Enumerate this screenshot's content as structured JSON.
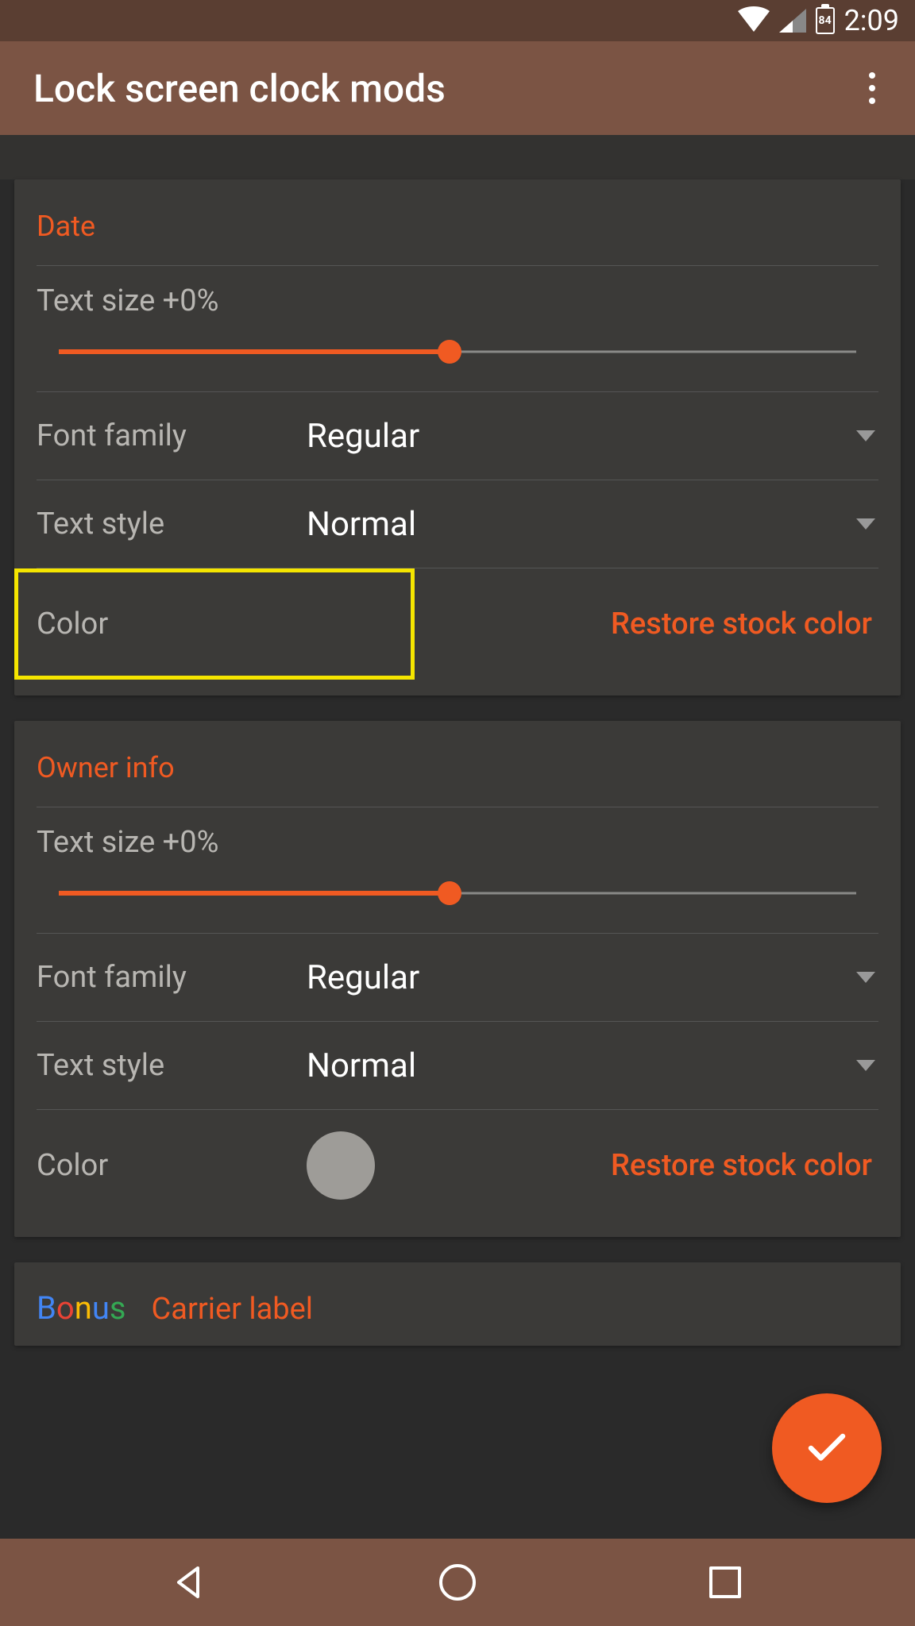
{
  "status": {
    "battery_level": "84",
    "time": "2:09"
  },
  "app_bar": {
    "title": "Lock screen clock mods"
  },
  "sections": {
    "date": {
      "title": "Date",
      "text_size_label": "Text size +0%",
      "slider_percent": 49,
      "font_family_label": "Font family",
      "font_family_value": "Regular",
      "text_style_label": "Text style",
      "text_style_value": "Normal",
      "color_label": "Color",
      "color_value": "#ffffff",
      "restore_label": "Restore stock color"
    },
    "owner": {
      "title": "Owner info",
      "text_size_label": "Text size +0%",
      "slider_percent": 49,
      "font_family_label": "Font family",
      "font_family_value": "Regular",
      "text_style_label": "Text style",
      "text_style_value": "Normal",
      "color_label": "Color",
      "color_value": "#9e9c98",
      "restore_label": "Restore stock color"
    },
    "bonus": {
      "title": "Bonus",
      "sub": "Carrier label"
    }
  },
  "colors": {
    "accent": "#f05a22",
    "yellow_highlight": "#f5e500"
  }
}
